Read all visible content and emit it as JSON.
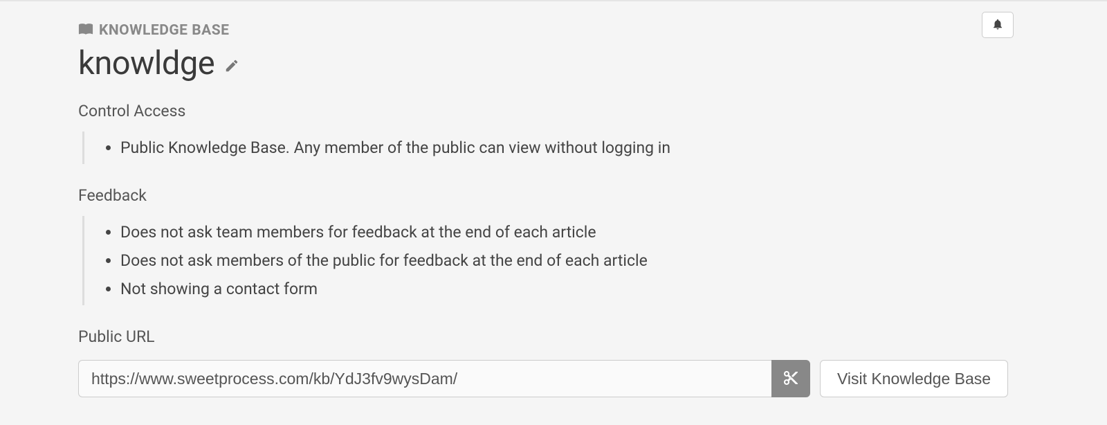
{
  "breadcrumb": {
    "label": "KNOWLEDGE BASE"
  },
  "title": "knowldge",
  "sections": {
    "access": {
      "label": "Control Access",
      "items": [
        "Public Knowledge Base. Any member of the public can view without logging in"
      ]
    },
    "feedback": {
      "label": "Feedback",
      "items": [
        "Does not ask team members for feedback at the end of each article",
        "Does not ask members of the public for feedback at the end of each article",
        "Not showing a contact form"
      ]
    },
    "url": {
      "label": "Public URL",
      "value": "https://www.sweetprocess.com/kb/YdJ3fv9wysDam/"
    }
  },
  "buttons": {
    "visit": "Visit Knowledge Base"
  }
}
